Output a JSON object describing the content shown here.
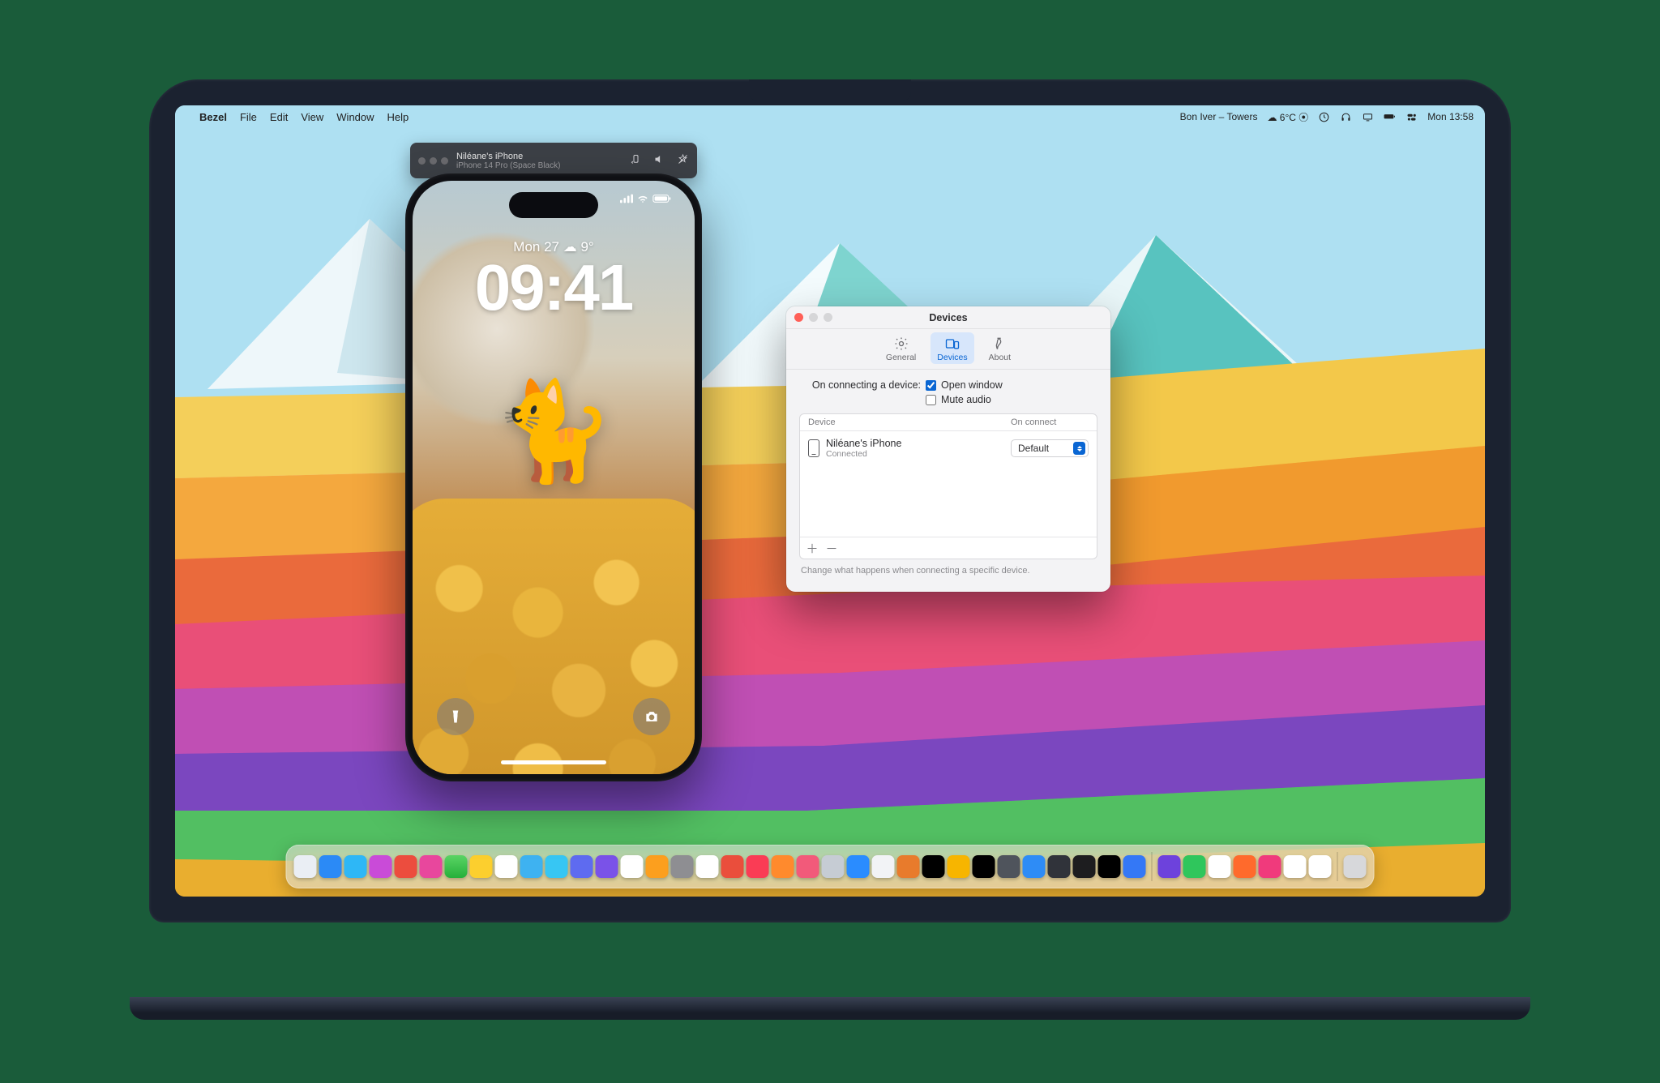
{
  "menubar": {
    "app_name": "Bezel",
    "items": [
      "File",
      "Edit",
      "View",
      "Window",
      "Help"
    ],
    "now_playing": "Bon Iver – Towers",
    "weather": "☁︎ 6°C ⦿",
    "clock": "Mon 13:58"
  },
  "bezel_bar": {
    "device_name": "Niléane's iPhone",
    "device_model": "iPhone 14 Pro (Space Black)"
  },
  "phone": {
    "date_line": "Mon 27 ☁︎ 9°",
    "time": "09:41"
  },
  "prefs": {
    "title": "Devices",
    "tabs": {
      "general": "General",
      "devices": "Devices",
      "about": "About"
    },
    "connect_label": "On connecting a device:",
    "open_window_label": "Open window",
    "open_window_checked": true,
    "mute_audio_label": "Mute audio",
    "mute_audio_checked": false,
    "columns": {
      "device": "Device",
      "on_connect": "On connect"
    },
    "device_row": {
      "name": "Niléane's iPhone",
      "status": "Connected",
      "on_connect": "Default"
    },
    "hint": "Change what happens when connecting a specific device."
  },
  "dock": {
    "colors": [
      "#eaeef4",
      "#2b8af6",
      "#2eb7f6",
      "#c94bd8",
      "#ec4d3e",
      "#e8479d",
      "linear-gradient(#5bd465,#25b03a)",
      "#fccf2e",
      "#fff",
      "#3eb2f1",
      "#37c6f3",
      "#5e6bf0",
      "#7a52e8",
      "#fff",
      "#fc9f1e",
      "#8e8e92",
      "#fff",
      "#ea4e3c",
      "#fa3c55",
      "#ff8a2d",
      "#f25a7a",
      "#c6ccd4",
      "#2a8cff",
      "#f2f3f6",
      "#e87b2c",
      "#000",
      "#f7b500",
      "#000",
      "#4f545c",
      "#2e8cf6",
      "#30333a",
      "#1d1d1f",
      "#000",
      "#3478f6",
      "#6d42dc",
      "#2fc65c",
      "#fff",
      "#ff6a2c",
      "#f03a7c",
      "#fff",
      "#fff",
      "#d7d8db"
    ],
    "sep_after": [
      33,
      40
    ]
  }
}
